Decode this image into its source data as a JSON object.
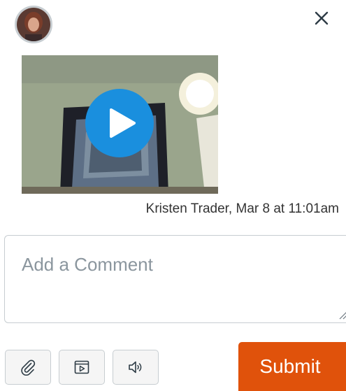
{
  "header": {
    "avatar_icon": "user-avatar",
    "close_icon": "close-icon"
  },
  "media": {
    "play_icon": "play-icon",
    "caption": "Kristen Trader, Mar 8 at 11:01am"
  },
  "comment": {
    "placeholder": "Add a Comment",
    "value": ""
  },
  "toolbar": {
    "attach_icon": "paperclip-icon",
    "video_icon": "video-icon",
    "audio_icon": "speaker-icon",
    "submit_label": "Submit"
  },
  "colors": {
    "accent": "#e0520b",
    "play": "#1a8fde",
    "close": "#2d3b45",
    "border": "#c7cdd1",
    "placeholder": "#8b969e"
  }
}
